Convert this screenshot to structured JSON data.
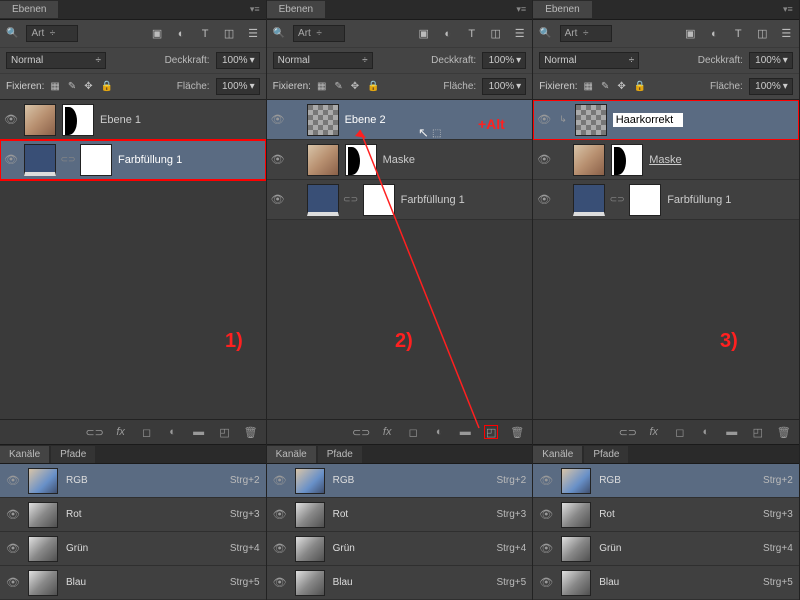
{
  "tabs": {
    "layers": "Ebenen",
    "channels": "Kanäle",
    "paths": "Pfade",
    "flyout_glyph": "▾≡"
  },
  "search": {
    "glyph": "🔍",
    "label": "Art",
    "dd": "÷"
  },
  "toolbar": {
    "img": "▣",
    "fx": "◐",
    "t": "T",
    "crop": "◫",
    "lock": "🔒",
    "menu": "☰"
  },
  "blend": {
    "mode": "Normal",
    "dd": "÷",
    "opacity_label": "Deckkraft:",
    "fill_label": "Fläche:",
    "val": "100%"
  },
  "lock": {
    "label": "Fixieren:",
    "pix": "▦",
    "brush": "✎",
    "move": "✥",
    "lock": "🔒"
  },
  "layers1": [
    {
      "name": "Ebene 1",
      "thumb": "face",
      "mask": true,
      "sel": false,
      "hl": false
    },
    {
      "name": "Farbfüllung 1",
      "thumb": "fill",
      "mask": false,
      "sel": true,
      "hl": true,
      "chain": true,
      "white": true
    }
  ],
  "layers2": [
    {
      "name": "Ebene 2",
      "thumb": "checker",
      "sel": true,
      "hl": false,
      "indent": true
    },
    {
      "name": "Maske",
      "thumb": "face",
      "mask": true,
      "sel": false,
      "indent": true
    },
    {
      "name": "Farbfüllung 1",
      "thumb": "fill",
      "white": true,
      "chain": true,
      "sel": false,
      "indent": true
    }
  ],
  "layers3": [
    {
      "rename": "Haarkorrekt",
      "thumb": "checker",
      "sel": true,
      "hl": true,
      "indent": true,
      "arrow": true
    },
    {
      "name": "Maske",
      "thumb": "face",
      "mask": true,
      "sel": false,
      "indent": true,
      "underline": true
    },
    {
      "name": "Farbfüllung 1",
      "thumb": "fill",
      "white": true,
      "chain": true,
      "sel": false,
      "indent": true
    }
  ],
  "bottom": {
    "link": "⊂⊃",
    "fx": "fx",
    "mask": "◻",
    "adj": "◐",
    "folder": "▬",
    "new": "◰",
    "trash": "🗑"
  },
  "channels": [
    {
      "name": "RGB",
      "shortcut": "Strg+2",
      "sel": true,
      "thumb": "rgb"
    },
    {
      "name": "Rot",
      "shortcut": "Strg+3",
      "thumb": "gray"
    },
    {
      "name": "Grün",
      "shortcut": "Strg+4",
      "thumb": "gray"
    },
    {
      "name": "Blau",
      "shortcut": "Strg+5",
      "thumb": "gray"
    }
  ],
  "step_labels": {
    "s1": "1)",
    "s2": "2)",
    "s3": "3)",
    "alt": "+Alt"
  },
  "eye_glyph": "👁",
  "cursor_glyph": "⬚"
}
